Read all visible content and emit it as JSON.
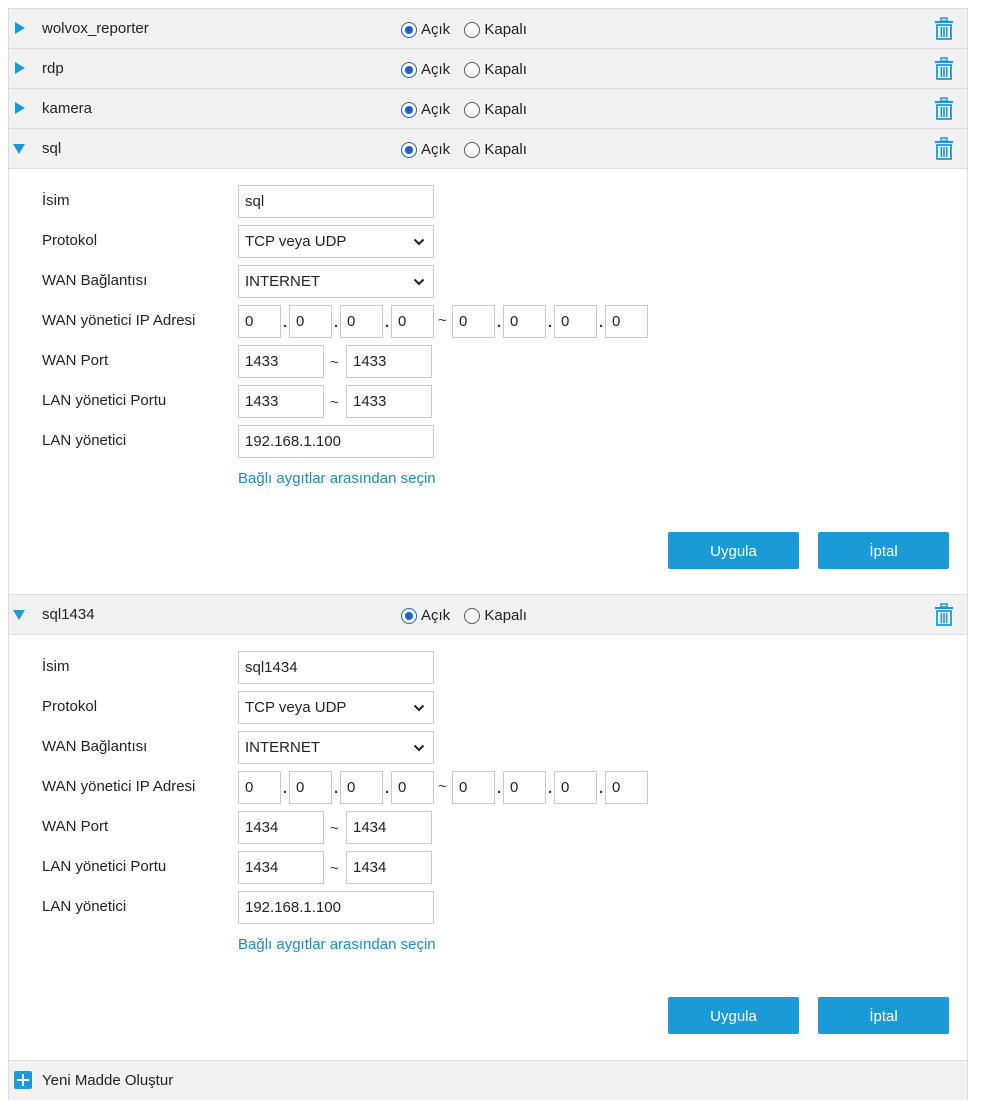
{
  "status_options": {
    "on": "Açık",
    "off": "Kapalı"
  },
  "collapsed_rules": [
    {
      "name": "wolvox_reporter"
    },
    {
      "name": "rdp"
    },
    {
      "name": "kamera"
    }
  ],
  "expanded_rules": [
    {
      "name": "sql",
      "form": {
        "name_label": "İsim",
        "name_value": "sql",
        "protocol_label": "Protokol",
        "protocol_value": "TCP veya UDP",
        "wan_label": "WAN Bağlantısı",
        "wan_value": "INTERNET",
        "wan_ip_label": "WAN yönetici IP Adresi",
        "ip_start": [
          "0",
          "0",
          "0",
          "0"
        ],
        "ip_end": [
          "0",
          "0",
          "0",
          "0"
        ],
        "wan_port_label": "WAN Port",
        "wan_port_start": "1433",
        "wan_port_end": "1433",
        "lan_port_label": "LAN yönetici Portu",
        "lan_port_start": "1433",
        "lan_port_end": "1433",
        "lan_host_label": "LAN yönetici",
        "lan_host_value": "192.168.1.100",
        "select_link": "Bağlı aygıtlar arasından seçin",
        "apply": "Uygula",
        "cancel": "İptal"
      }
    },
    {
      "name": "sql1434",
      "form": {
        "name_label": "İsim",
        "name_value": "sql1434",
        "protocol_label": "Protokol",
        "protocol_value": "TCP veya UDP",
        "wan_label": "WAN Bağlantısı",
        "wan_value": "INTERNET",
        "wan_ip_label": "WAN yönetici IP Adresi",
        "ip_start": [
          "0",
          "0",
          "0",
          "0"
        ],
        "ip_end": [
          "0",
          "0",
          "0",
          "0"
        ],
        "wan_port_label": "WAN Port",
        "wan_port_start": "1434",
        "wan_port_end": "1434",
        "lan_port_label": "LAN yönetici Portu",
        "lan_port_start": "1434",
        "lan_port_end": "1434",
        "lan_host_label": "LAN yönetici",
        "lan_host_value": "192.168.1.100",
        "select_link": "Bağlı aygıtlar arasından seçin",
        "apply": "Uygula",
        "cancel": "İptal"
      }
    }
  ],
  "add_new": {
    "label": "Yeni Madde Oluştur",
    "icon": "plus-icon"
  },
  "colors": {
    "accent": "#1a9ad6",
    "row_bg": "#f2f2f2",
    "border": "#dcdcdc",
    "radio": "#1a62c9"
  },
  "icons": {
    "expand": "triangle-right-icon",
    "collapse": "triangle-down-icon",
    "delete": "trash-icon"
  }
}
